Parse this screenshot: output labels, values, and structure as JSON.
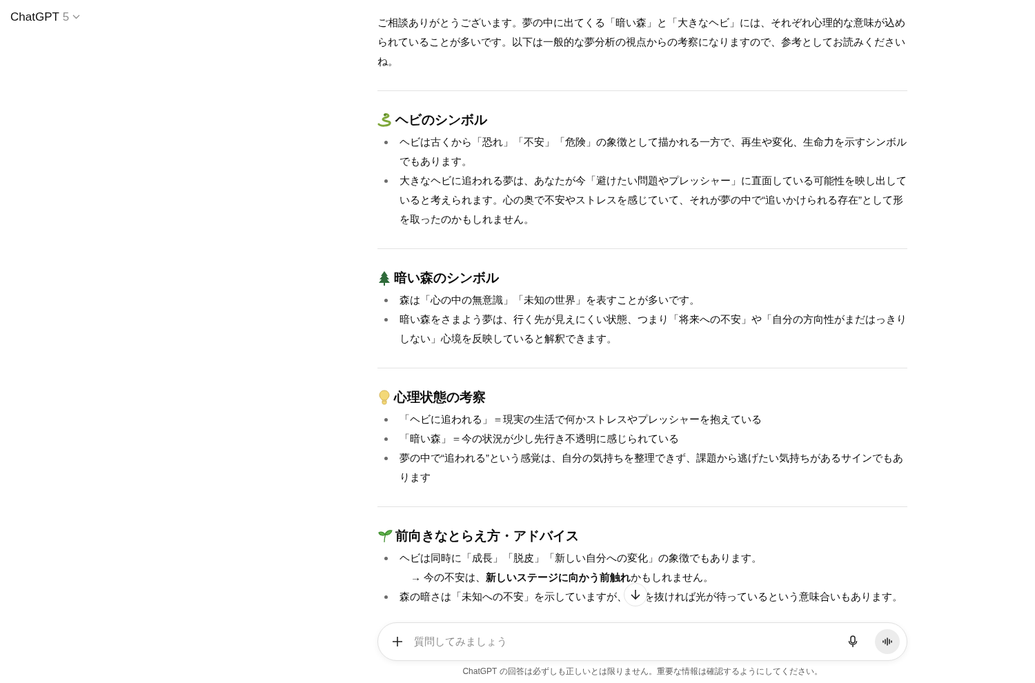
{
  "header": {
    "title": "ChatGPT",
    "version": "5"
  },
  "intro": "ご相談ありがとうございます。夢の中に出てくる「暗い森」と「大きなヘビ」には、それぞれ心理的な意味が込められていることが多いです。以下は一般的な夢分析の視点からの考察になりますので、参考としてお読みくださいね。",
  "sections": [
    {
      "heading": "ヘビのシンボル",
      "items": [
        {
          "text": "ヘビは古くから「恐れ」「不安」「危険」の象徴として描かれる一方で、再生や変化、生命力を示すシンボルでもあります。"
        },
        {
          "text": "大きなヘビに追われる夢は、あなたが今「避けたい問題やプレッシャー」に直面している可能性を映し出していると考えられます。心の奥で不安やストレスを感じていて、それが夢の中で“追いかけられる存在”として形を取ったのかもしれません。"
        }
      ]
    },
    {
      "heading": "暗い森のシンボル",
      "items": [
        {
          "text": "森は「心の中の無意識」「未知の世界」を表すことが多いです。"
        },
        {
          "text": "暗い森をさまよう夢は、行く先が見えにくい状態、つまり「将来への不安」や「自分の方向性がまだはっきりしない」心境を反映していると解釈できます。"
        }
      ]
    },
    {
      "heading": "心理状態の考察",
      "items": [
        {
          "text": "「ヘビに追われる」＝現実の生活で何かストレスやプレッシャーを抱えている"
        },
        {
          "text": "「暗い森」＝今の状況が少し先行き不透明に感じられている"
        },
        {
          "text": "夢の中で“追われる”という感覚は、自分の気持ちを整理できず、課題から逃げたい気持ちがあるサインでもあります"
        }
      ]
    },
    {
      "heading": "前向きなとらえ方・アドバイス",
      "items": [
        {
          "text": "ヘビは同時に「成長」「脱皮」「新しい自分への変化」の象徴でもあります。",
          "note": "→ 今の不安は、**新しいステージに向かう前触れ**かもしれません。"
        },
        {
          "text": "森の暗さは「未知への不安」を示していますが、",
          "text_after": "を抜ければ光が待っているという意味合いもあります。"
        }
      ]
    }
  ],
  "composer": {
    "placeholder": "質問してみましょう"
  },
  "disclaimer": "ChatGPT の回答は必ずしも正しいとは限りません。重要な情報は確認するようにしてください。"
}
